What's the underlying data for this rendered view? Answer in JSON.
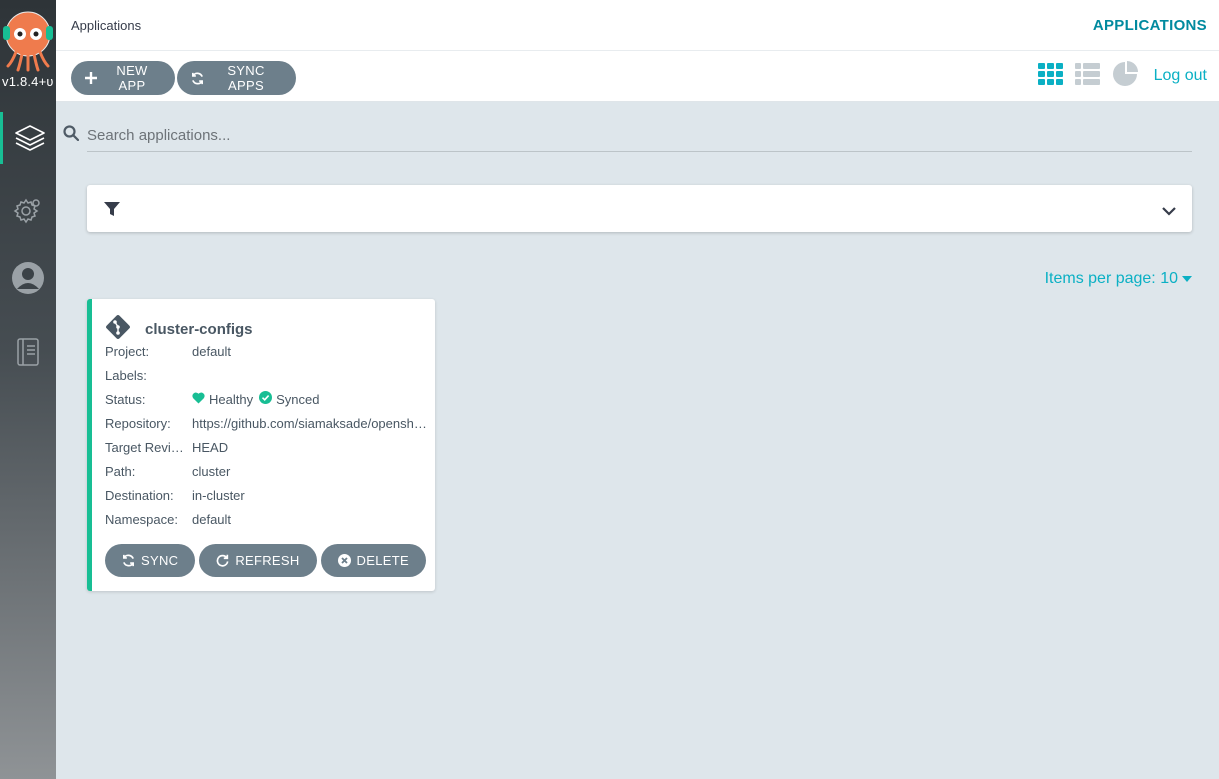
{
  "colors": {
    "accent": "#0bb0c4",
    "healthy": "#18be94",
    "button": "#6d7f8b",
    "sidebar_top": "#2e3438"
  },
  "sidebar": {
    "version": "v1.8.4+ʋ",
    "items": [
      {
        "icon": "layers-icon",
        "active": true
      },
      {
        "icon": "gear-icon",
        "active": false
      },
      {
        "icon": "user-icon",
        "active": false
      },
      {
        "icon": "docs-icon",
        "active": false
      }
    ]
  },
  "header": {
    "title": "Applications",
    "right_title": "APPLICATIONS"
  },
  "toolbar": {
    "new_app_label": "NEW APP",
    "sync_apps_label": "SYNC APPS",
    "logout_label": "Log out",
    "views": [
      "tiles-view-icon",
      "list-view-icon",
      "summary-pie-icon"
    ]
  },
  "search": {
    "placeholder": "Search applications...",
    "value": ""
  },
  "pagination": {
    "items_per_page_label": "Items per page: 10"
  },
  "apps": [
    {
      "name": "cluster-configs",
      "fields": [
        {
          "key": "Project:",
          "value": "default"
        },
        {
          "key": "Labels:",
          "value": ""
        },
        {
          "key": "Status:",
          "value": ""
        },
        {
          "key": "Repository:",
          "value": "https://github.com/siamaksade/openshift-gitops-getting-started"
        },
        {
          "key": "Target Revision:",
          "value": "HEAD"
        },
        {
          "key": "Path:",
          "value": "cluster"
        },
        {
          "key": "Destination:",
          "value": "in-cluster"
        },
        {
          "key": "Namespace:",
          "value": "default"
        }
      ],
      "health": "Healthy",
      "sync": "Synced",
      "actions": {
        "sync_label": "SYNC",
        "refresh_label": "REFRESH",
        "delete_label": "DELETE"
      }
    }
  ]
}
